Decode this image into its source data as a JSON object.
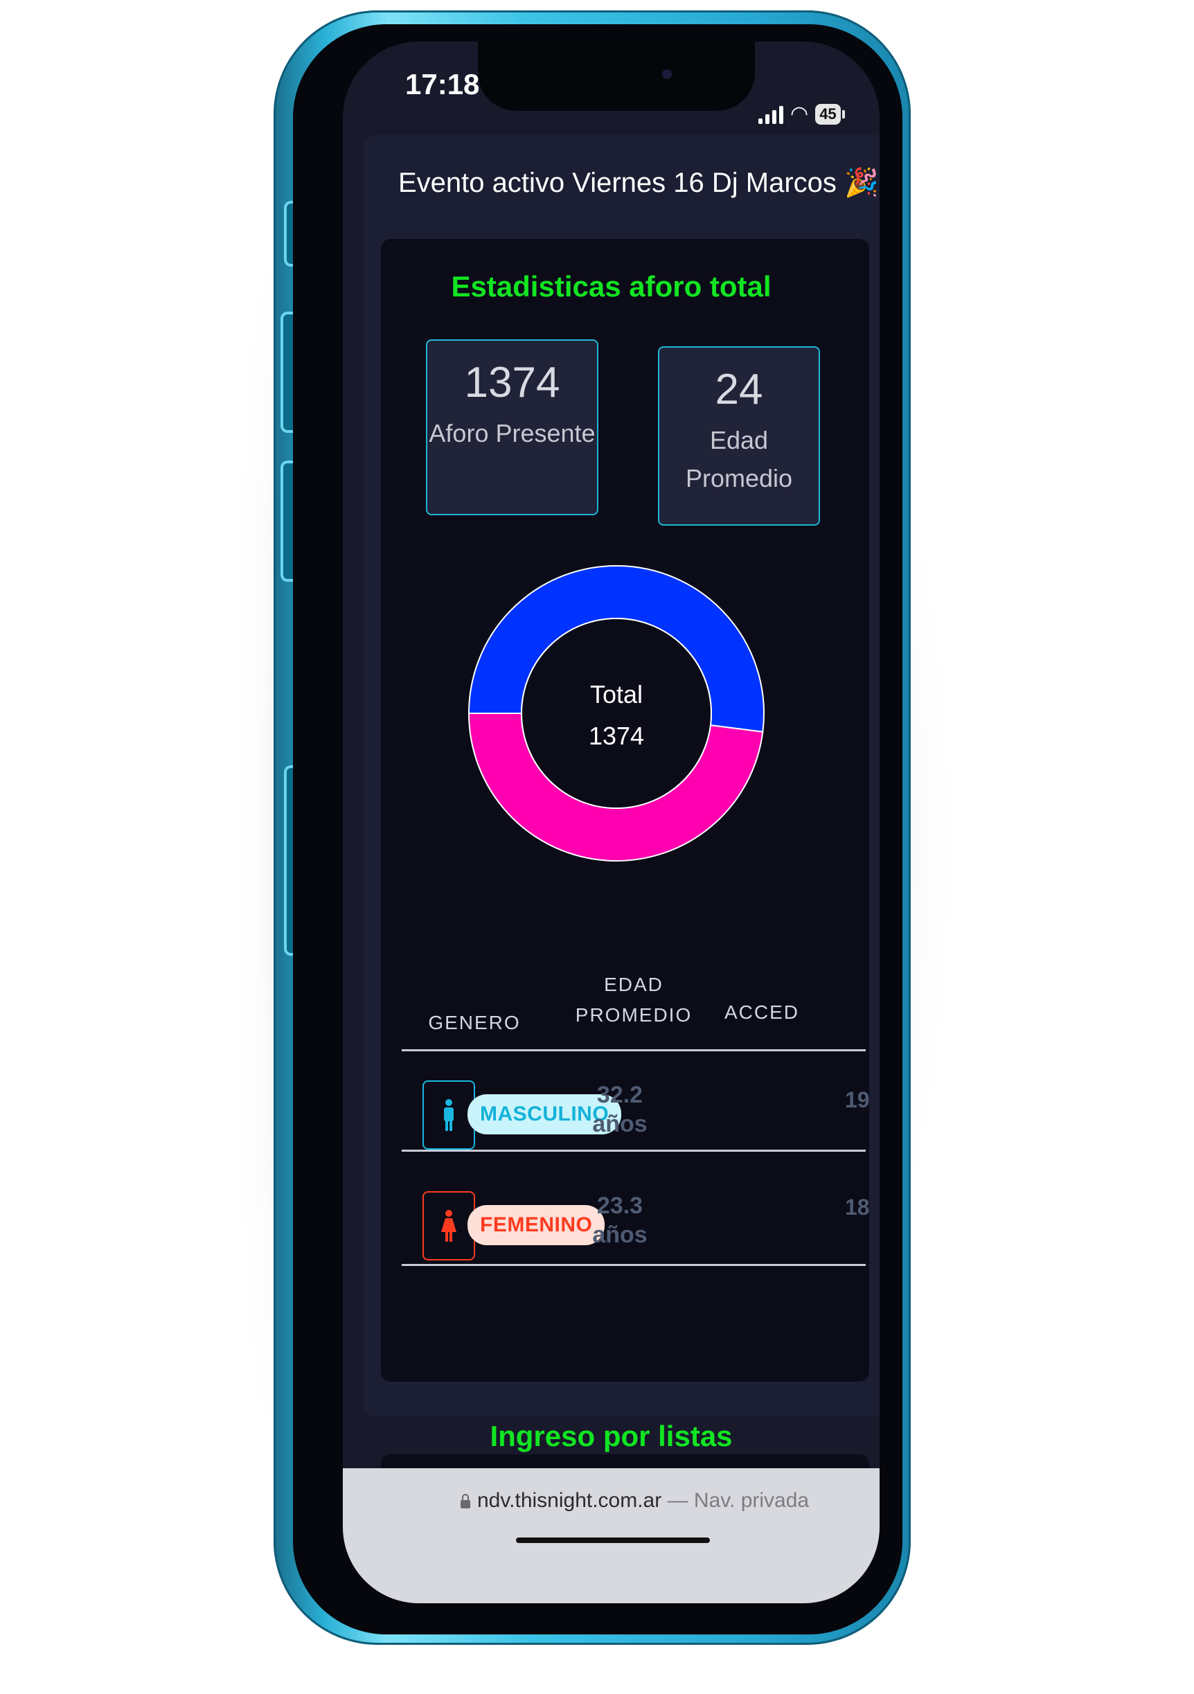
{
  "status": {
    "time": "17:18",
    "battery": "45"
  },
  "event": {
    "title": "Evento activo Viernes 16 Dj Marcos 🎉"
  },
  "stats": {
    "title": "Estadisticas aforo total",
    "aforo_value": "1374",
    "aforo_label": "Aforo Presente",
    "edad_value": "24",
    "edad_label_1": "Edad",
    "edad_label_2": "Promedio"
  },
  "donut": {
    "center_label": "Total",
    "center_value": "1374",
    "colors": {
      "masculino": "#0033ff",
      "femenino": "#ff00b0"
    }
  },
  "chart_data": {
    "type": "pie",
    "categories": [
      "MASCULINO",
      "FEMENINO"
    ],
    "values": [
      52,
      48
    ],
    "title": "",
    "center_text": [
      "Total",
      "1374"
    ]
  },
  "table": {
    "headers": {
      "genero": "GENERO",
      "edad_1": "EDAD",
      "edad_2": "PROMEDIO",
      "acceso": "ACCED"
    },
    "rows": [
      {
        "genero": "MASCULINO",
        "edad": "32.2",
        "unit": "años",
        "acceso": "19",
        "icon": "male-icon",
        "color": "#18b8e0",
        "badge_bg": "#c9f4fc"
      },
      {
        "genero": "FEMENINO",
        "edad": "23.3",
        "unit": "años",
        "acceso": "18",
        "icon": "female-icon",
        "color": "#ff3b1f",
        "badge_bg": "#ffe0d8"
      }
    ]
  },
  "section2": {
    "title": "Ingreso por listas"
  },
  "browser": {
    "url": "ndv.thisnight.com.ar",
    "mode": "— Nav. privada"
  }
}
